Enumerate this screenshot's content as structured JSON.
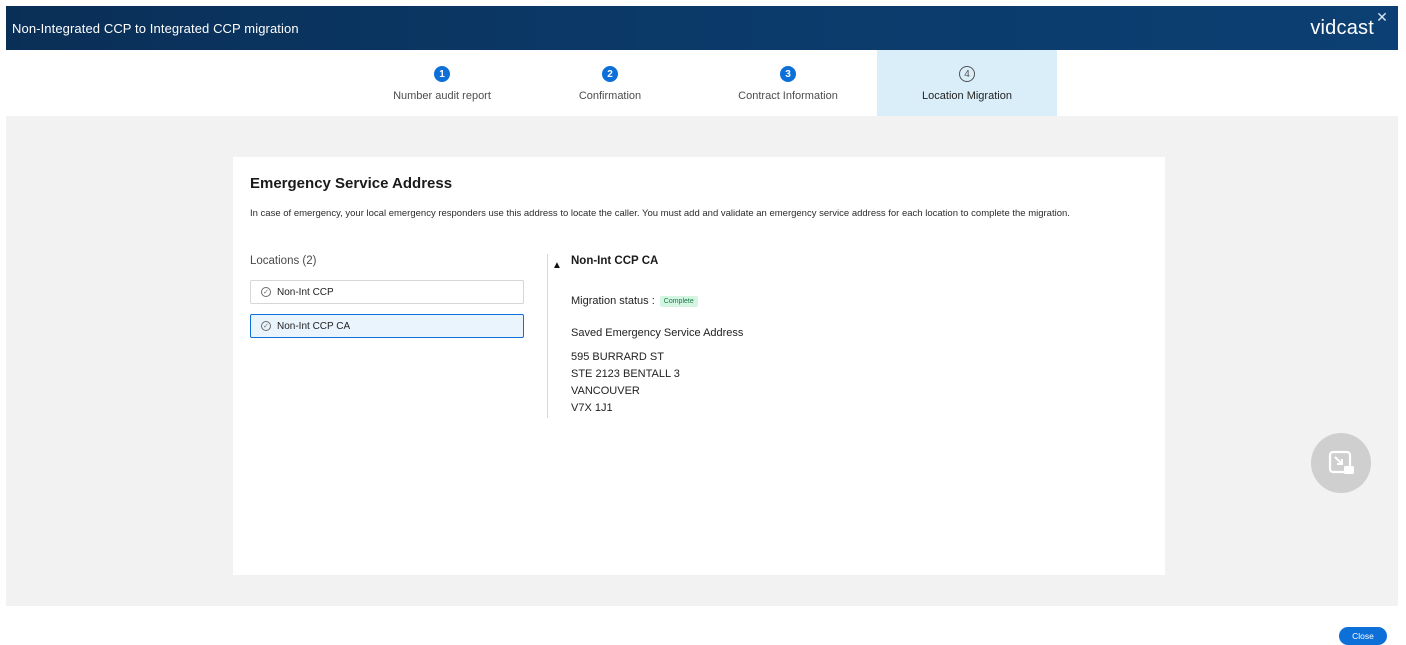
{
  "header": {
    "title": "Non-Integrated CCP to Integrated CCP migration",
    "brand": "vidcast",
    "close_icon": "close-x-icon"
  },
  "stepper": {
    "steps": [
      {
        "number": "1",
        "label": "Number audit report",
        "state": "done"
      },
      {
        "number": "2",
        "label": "Confirmation",
        "state": "done"
      },
      {
        "number": "3",
        "label": "Contract Information",
        "state": "done"
      },
      {
        "number": "4",
        "label": "Location Migration",
        "state": "active"
      }
    ]
  },
  "card": {
    "title": "Emergency Service Address",
    "description": "In case of emergency, your local emergency responders use this address to locate the caller. You must add and validate an emergency service address for each location to complete the migration."
  },
  "locations": {
    "header": "Locations (2)",
    "items": [
      {
        "label": "Non-Int CCP",
        "selected": false
      },
      {
        "label": "Non-Int CCP CA",
        "selected": true
      }
    ]
  },
  "detail": {
    "name": "Non-Int CCP CA",
    "status_label": "Migration status :",
    "status_value": "Complete",
    "saved_label": "Saved Emergency Service Address",
    "address_lines": [
      "595 BURRARD ST",
      "STE 2123 BENTALL 3",
      "VANCOUVER",
      "V7X 1J1"
    ]
  },
  "footer": {
    "close_label": "Close"
  },
  "colors": {
    "accent": "#0d6fd8",
    "header_bg": "#0b3b6b",
    "active_step_bg": "#daeefa",
    "badge_bg": "#d5f5e3"
  },
  "icons": {
    "step_check": "circle-check-icon",
    "pip": "picture-in-picture-icon",
    "cursor": "mouse-pointer-icon"
  }
}
